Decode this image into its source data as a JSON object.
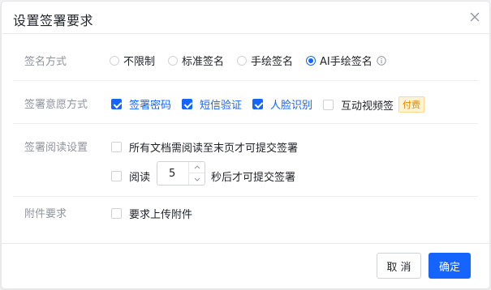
{
  "dialog": {
    "title": "设置签署要求"
  },
  "sign_method": {
    "label": "签名方式",
    "options": [
      {
        "label": "不限制",
        "selected": false
      },
      {
        "label": "标准签名",
        "selected": false
      },
      {
        "label": "手绘签名",
        "selected": false
      },
      {
        "label": "AI手绘签名",
        "selected": true
      }
    ],
    "info_icon": "info-circle-icon"
  },
  "sign_intent": {
    "label": "签署意愿方式",
    "options": [
      {
        "label": "签署密码",
        "checked": true
      },
      {
        "label": "短信验证",
        "checked": true
      },
      {
        "label": "人脸识别",
        "checked": true
      },
      {
        "label": "互动视频签",
        "checked": false,
        "badge": "付费"
      }
    ]
  },
  "reading": {
    "label": "签署阅读设置",
    "read_to_end": {
      "label": "所有文档需阅读至末页才可提交签署",
      "checked": false
    },
    "read_seconds": {
      "prefix": "阅读",
      "value": "5",
      "suffix": "秒后才可提交签署",
      "checked": false
    }
  },
  "attachment": {
    "label": "附件要求",
    "require_upload": {
      "label": "要求上传附件",
      "checked": false
    }
  },
  "footer": {
    "cancel_label": "取 消",
    "ok_label": "确定"
  },
  "colors": {
    "primary": "#1664ff",
    "badge_text": "#e08a00",
    "badge_bg": "#fff3d6"
  }
}
